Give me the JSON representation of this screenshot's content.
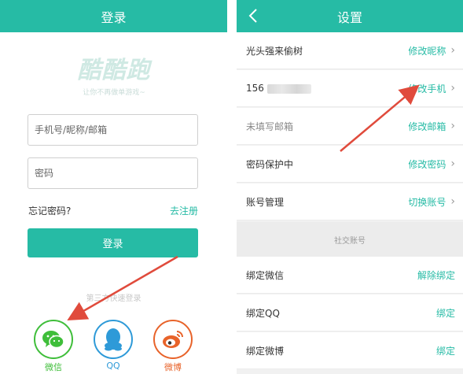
{
  "login": {
    "title": "登录",
    "logo_text": "酷酷跑",
    "logo_tagline": "让你不再做单游戏~",
    "phone_placeholder": "手机号/昵称/邮箱",
    "password_placeholder": "密码",
    "forgot_label": "忘记密码?",
    "register_label": "去注册",
    "login_button": "登录",
    "third_party_hint": "第三方快速登录",
    "social": {
      "wechat": "微信",
      "qq": "QQ",
      "weibo": "微博"
    }
  },
  "settings": {
    "title": "设置",
    "rows": [
      {
        "label": "光头强来偷树",
        "action": "修改昵称"
      },
      {
        "label": "156",
        "action": "修改手机"
      },
      {
        "label": "未填写邮箱",
        "action": "修改邮箱"
      },
      {
        "label": "密码保护中",
        "action": "修改密码"
      },
      {
        "label": "账号管理",
        "action": "切换账号"
      }
    ],
    "social_section": "社交账号",
    "social_rows": [
      {
        "label": "绑定微信",
        "action": "解除绑定"
      },
      {
        "label": "绑定QQ",
        "action": "绑定"
      },
      {
        "label": "绑定微博",
        "action": "绑定"
      }
    ]
  },
  "colors": {
    "accent": "#26bba5",
    "wechat": "#3fbe3a",
    "qq": "#2e9ad8",
    "weibo": "#e8632a",
    "annotation_arrow": "#e04b3c"
  },
  "icons": [
    "back-icon",
    "chevron-right-icon",
    "wechat-icon",
    "qq-icon",
    "weibo-icon"
  ]
}
